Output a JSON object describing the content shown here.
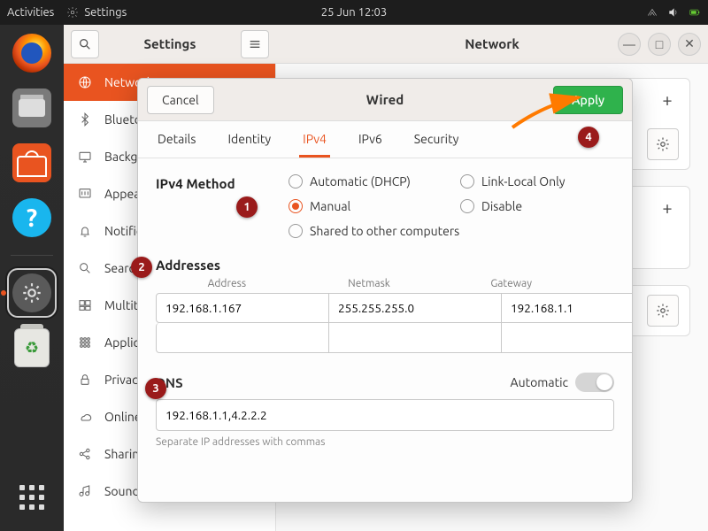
{
  "topbar": {
    "activities": "Activities",
    "app_name": "Settings",
    "datetime": "25 Jun  12:03"
  },
  "settings": {
    "left_title": "Settings",
    "main_title": "Network",
    "sidebar": [
      {
        "icon": "globe",
        "label": "Network",
        "active": true
      },
      {
        "icon": "bluetooth",
        "label": "Bluetooth"
      },
      {
        "icon": "display",
        "label": "Background"
      },
      {
        "icon": "appearance",
        "label": "Appearance"
      },
      {
        "icon": "bell",
        "label": "Notifications"
      },
      {
        "icon": "search",
        "label": "Search"
      },
      {
        "icon": "multi",
        "label": "Multitasking"
      },
      {
        "icon": "apps",
        "label": "Applications"
      },
      {
        "icon": "lock",
        "label": "Privacy"
      },
      {
        "icon": "cloud",
        "label": "Online Accounts"
      },
      {
        "icon": "share",
        "label": "Sharing"
      },
      {
        "icon": "sound",
        "label": "Sound"
      }
    ]
  },
  "dialog": {
    "title": "Wired",
    "cancel": "Cancel",
    "apply": "Apply",
    "tabs": [
      "Details",
      "Identity",
      "IPv4",
      "IPv6",
      "Security"
    ],
    "active_tab": "IPv4",
    "method_label": "IPv4 Method",
    "methods": {
      "auto": "Automatic (DHCP)",
      "linklocal": "Link-Local Only",
      "manual": "Manual",
      "disable": "Disable",
      "shared": "Shared to other computers"
    },
    "addresses_label": "Addresses",
    "addr_cols": {
      "address": "Address",
      "netmask": "Netmask",
      "gateway": "Gateway"
    },
    "rows": [
      {
        "address": "192.168.1.167",
        "netmask": "255.255.255.0",
        "gateway": "192.168.1.1"
      },
      {
        "address": "",
        "netmask": "",
        "gateway": ""
      }
    ],
    "dns_label": "DNS",
    "dns_auto": "Automatic",
    "dns_value": "192.168.1.1,4.2.2.2",
    "dns_hint": "Separate IP addresses with commas"
  },
  "markers": {
    "1": "1",
    "2": "2",
    "3": "3",
    "4": "4"
  }
}
